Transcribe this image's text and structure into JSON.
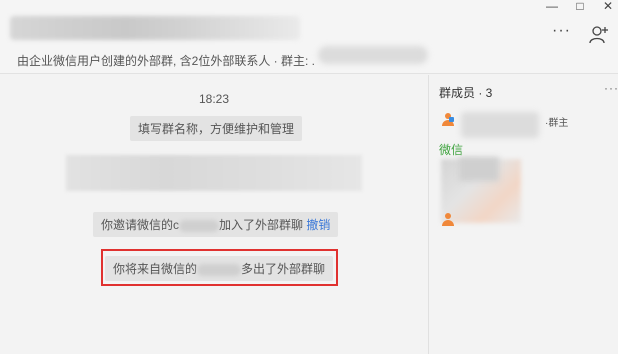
{
  "window": {
    "minimize_label": "—",
    "maximize_label": "□",
    "close_label": "✕"
  },
  "header": {
    "subtitle": "由企业微信用户创建的外部群, 含2位外部联系人 · 群主: ."
  },
  "chat": {
    "time": "18:23",
    "messages": {
      "fill_name": "填写群名称，方便维护和管理",
      "invite_prefix": "你邀请微信的c",
      "invite_suffix": "加入了外部群聊",
      "invite_link": "撤销",
      "joined_prefix": "你将来自微信的",
      "joined_suffix": "多出了外部群聊"
    }
  },
  "members": {
    "title": "群成员 · 3",
    "more": "···",
    "owner_tag": "·群主",
    "wechat_label": "微信"
  },
  "colors": {
    "accent_link": "#3b78d8",
    "wechat_green": "#3fa33f",
    "highlight_red": "#e0312f",
    "member_icon": "#f0883a"
  }
}
